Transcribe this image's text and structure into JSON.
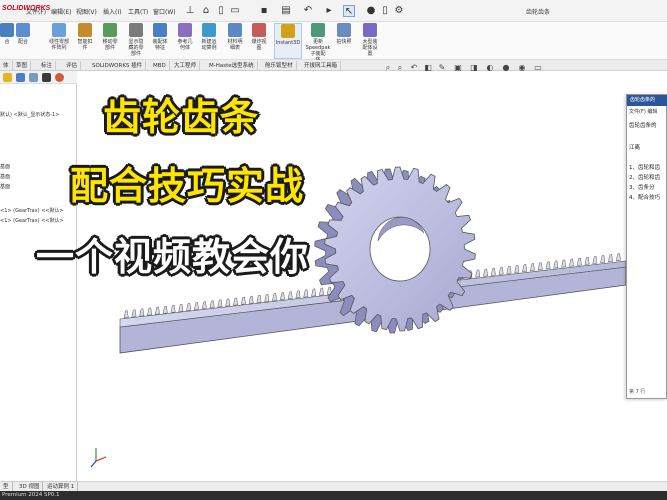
{
  "app": {
    "logo": "SOLIDWORKS",
    "window_title": "齿轮齿条"
  },
  "menu": [
    "文件(F)",
    "编辑(E)",
    "视图(V)",
    "插入(I)",
    "工具(T)",
    "窗口(W)"
  ],
  "ribbon": [
    {
      "label": "合",
      "color": "#4a7fc1"
    },
    {
      "label": "配合",
      "color": "#5b8fd0"
    },
    {
      "label": "线性零部\n件阵列",
      "color": "#6aa0d8"
    },
    {
      "label": "智能扣\n件",
      "color": "#c58a2c"
    },
    {
      "label": "移动零\n部件",
      "color": "#5a9a5a"
    },
    {
      "label": "显示隐\n藏的零\n部件",
      "color": "#7a7a7a"
    },
    {
      "label": "装配体\n特征",
      "color": "#4a7fc1"
    },
    {
      "label": "参考几\n何体",
      "color": "#8a6fc1"
    },
    {
      "label": "新建运\n动算例",
      "color": "#3d9ac9"
    },
    {
      "label": "材料明\n细表",
      "color": "#5a8ac1"
    },
    {
      "label": "爆炸视\n图",
      "color": "#c55a5a"
    },
    {
      "label": "Instant3D",
      "color": "#d4a017"
    },
    {
      "label": "更新\nSpeedpak\n子装配\n体",
      "color": "#4a9a7a"
    },
    {
      "label": "拍快照",
      "color": "#6a8ac1"
    },
    {
      "label": "大型装\n配体设\n置",
      "color": "#7a6ac1"
    }
  ],
  "tabs": [
    "体",
    "草图",
    "标注",
    "评估",
    "SOLIDWORKS 插件",
    "MBD",
    "大工程师",
    "M-Haste选型系统",
    "舱乐钣型材",
    "开拔网工具箱"
  ],
  "tree": [
    "默认) <默认_显示状态-1>",
    "",
    "",
    "基面",
    "基面",
    "基面",
    "",
    "<1> (GearTrax) <<默认>",
    "<1> (GearTrax) <<默认>"
  ],
  "doc_window": {
    "title": "齿轮齿条的",
    "menu": "文件(F)  编辑",
    "lines": [
      "齿轮齿条的",
      "",
      "江离",
      "",
      "1、齿轮和齿",
      "2、齿轮和齿",
      "3、齿条分",
      "4、配合技巧"
    ],
    "page": "第 7 行"
  },
  "overlay": {
    "line1": "齿轮齿条",
    "line2": "配合技巧实战",
    "line3": "一个视频教会你"
  },
  "bottom_tabs": [
    "型",
    "3D 视图",
    "运动算例 1"
  ],
  "status": "Premium 2024 SP0.1",
  "colors": {
    "overlay_yellow": "#ffe600",
    "overlay_white": "#ffffff",
    "part_fill": "#c8c8e8",
    "part_edge": "#555"
  }
}
